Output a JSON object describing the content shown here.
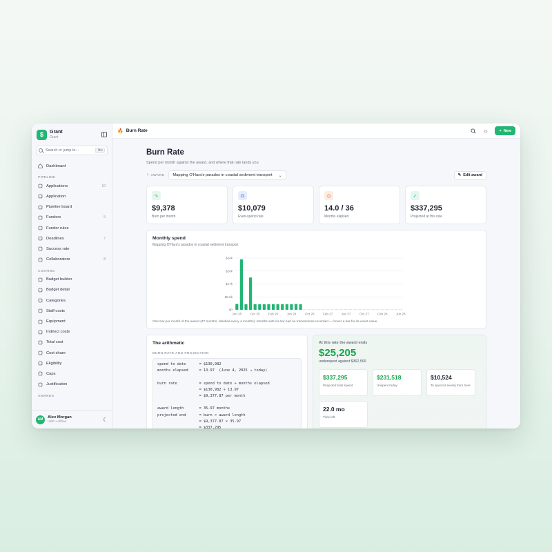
{
  "sidebar": {
    "brand_name": "Grant",
    "brand_sub": "Grant",
    "logo_glyph": "$",
    "search_placeholder": "Search or jump to...",
    "search_kbd": "⌘K",
    "dashboard": "Dashboard",
    "section_pipeline": "PIPELINE",
    "pipeline": [
      {
        "label": "Applications",
        "count": "10",
        "icon": "file-icon"
      },
      {
        "label": "Application",
        "count": "",
        "icon": "eye-icon"
      },
      {
        "label": "Pipeline board",
        "count": "",
        "icon": "layers-icon"
      },
      {
        "label": "Funders",
        "count": "5",
        "icon": "bank-icon"
      },
      {
        "label": "Funder rules",
        "count": "",
        "icon": "percent-icon"
      },
      {
        "label": "Deadlines",
        "count": "7",
        "icon": "calendar-icon"
      },
      {
        "label": "Success rate",
        "count": "",
        "icon": "target-icon"
      },
      {
        "label": "Collaborators",
        "count": "8",
        "icon": "users-icon"
      }
    ],
    "section_costing": "COSTING",
    "costing": [
      {
        "label": "Budget builder",
        "icon": "clipboard-icon"
      },
      {
        "label": "Budget detail",
        "icon": "list-icon"
      },
      {
        "label": "Categories",
        "icon": "pie-icon"
      },
      {
        "label": "Staff costs",
        "icon": "users-icon"
      },
      {
        "label": "Equipment",
        "icon": "box-icon"
      },
      {
        "label": "Indirect costs",
        "icon": "percent-icon"
      },
      {
        "label": "Total cost",
        "icon": "coin-icon"
      },
      {
        "label": "Cost share",
        "icon": "file-icon"
      },
      {
        "label": "Eligibility",
        "icon": "shield-icon"
      },
      {
        "label": "Caps",
        "icon": "scale-icon"
      },
      {
        "label": "Justification",
        "icon": "text-icon"
      }
    ],
    "section_awards": "AWARDS",
    "user_initials": "AM",
    "user_name": "Alex Morgan",
    "user_sub": "USD • offline"
  },
  "topbar": {
    "title": "Burn Rate",
    "new_label": "New"
  },
  "page": {
    "title": "Burn Rate",
    "subtitle": "Spend per month against the award, and where that rate lands you",
    "award_label": "AWARD",
    "award_value": "Mapping O'Hara's paradox in coastal sediment transport",
    "edit_label": "Edit award"
  },
  "kpis": [
    {
      "value": "$9,378",
      "label": "Burn per month",
      "icon": "activity-icon",
      "bg": "#e6f6ee",
      "fg": "#22b573"
    },
    {
      "value": "$10,079",
      "label": "Even-spend rate",
      "icon": "scale-icon",
      "bg": "#e6edfb",
      "fg": "#3b6fd6"
    },
    {
      "value": "14.0 / 36",
      "label": "Months elapsed",
      "icon": "clock-icon",
      "bg": "#fcece2",
      "fg": "#e0793a"
    },
    {
      "value": "$337,295",
      "label": "Projected at this rate",
      "icon": "check-icon",
      "bg": "#e6f6ee",
      "fg": "#22b573"
    }
  ],
  "chart_card": {
    "title": "Monthly spend",
    "subtitle": "Mapping O'Hara's paradox in coastal sediment transport",
    "note": "One bar per month of the award (37 months, labelled every 4 months). Months with no bar had no transactions recorded — hover a bar for its exact value."
  },
  "chart_data": {
    "type": "bar",
    "x_tick_labels": [
      "Jun 25",
      "Oct 25",
      "Feb 26",
      "Jun 26",
      "Oct 26",
      "Feb 27",
      "Jun 27",
      "Oct 27",
      "Feb 28",
      "Jun 28"
    ],
    "y_tick_labels": [
      "$0",
      "$8.6k",
      "$17k",
      "$26k",
      "$34k"
    ],
    "ylim": [
      0,
      34400
    ],
    "values": [
      3900,
      33600,
      3700,
      21500,
      3800,
      3700,
      3700,
      3800,
      3800,
      3800,
      3800,
      3800,
      3700,
      3900,
      3700,
      0,
      0,
      0,
      0,
      0,
      0,
      0,
      0,
      0,
      0,
      0,
      0,
      0,
      0,
      0,
      0,
      0,
      0,
      0,
      0,
      0,
      0
    ],
    "bar_color": "#22b573",
    "grid": true
  },
  "arithmetic": {
    "title": "The arithmetic",
    "subtitle": "BURN RATE AND PROJECTION",
    "code": "spend to date      = $130,982\nmonths elapsed     = 13.97  (June 4, 2025 → today)\n\nburn rate          = spend to date ÷ months elapsed\n                   = $130,982 ÷ 13.97\n                   = $9,377.87 per month\n\naward length       = 35.97 months\nprojected end      = burn × award length\n                   = $9,377.87 × 35.97\n                   = $337,295"
  },
  "projection": {
    "heading": "At this rate the award ends",
    "big": "$25,205",
    "under": "underspent against $362,500",
    "stats": [
      {
        "value": "$337,295",
        "label": "Projected total spend",
        "color": "#16a34a"
      },
      {
        "value": "$231,518",
        "label": "Unspent today",
        "color": "#16a34a"
      },
      {
        "value": "$10,524",
        "label": "To spend it evenly from here",
        "color": "#1f2430"
      },
      {
        "value": "22.0 mo",
        "label": "Time left",
        "color": "#1f2430"
      }
    ]
  }
}
